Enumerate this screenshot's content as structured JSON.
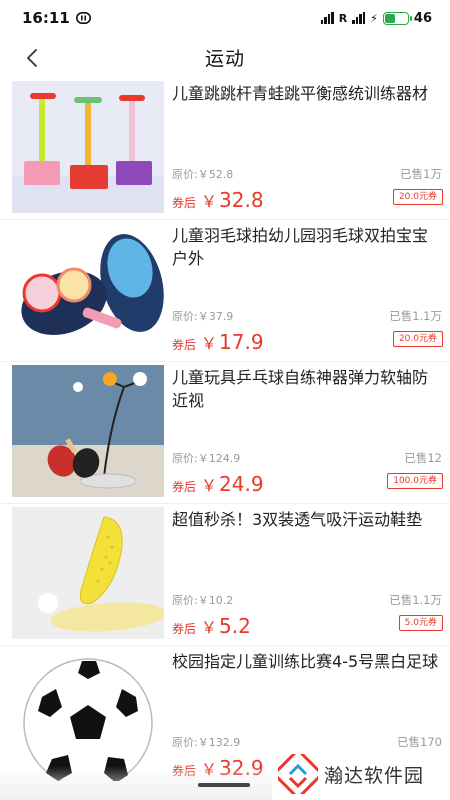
{
  "status_bar": {
    "time": "16:11",
    "battery": "46",
    "battery_level": 0.46
  },
  "nav": {
    "title": "运动"
  },
  "products": [
    {
      "title": "儿童跳跳杆青蛙跳平衡感统训练器材",
      "original_price": "原价:￥52.8",
      "sold": "已售1万",
      "label": "券后",
      "currency": "￥",
      "price": "32.8",
      "coupon": "20.0元券",
      "image": "pogo-jumper-image"
    },
    {
      "title": "儿童羽毛球拍幼儿园羽毛球双拍宝宝户外",
      "original_price": "原价:￥37.9",
      "sold": "已售1.1万",
      "label": "券后",
      "currency": "￥",
      "price": "17.9",
      "coupon": "20.0元券",
      "image": "badminton-racket-image"
    },
    {
      "title": "儿童玩具乒乓球自练神器弹力软轴防近视",
      "original_price": "原价:￥124.9",
      "sold": "已售12",
      "label": "券后",
      "currency": "￥",
      "price": "24.9",
      "coupon": "100.0元券",
      "image": "table-tennis-trainer-image"
    },
    {
      "title": "超值秒杀！3双装透气吸汗运动鞋垫",
      "original_price": "原价:￥10.2",
      "sold": "已售1.1万",
      "label": "券后",
      "currency": "￥",
      "price": "5.2",
      "coupon": "5.0元券",
      "image": "insole-image"
    },
    {
      "title": "校园指定儿童训练比赛4-5号黑白足球",
      "original_price": "原价:￥132.9",
      "sold": "已售170",
      "label": "券后",
      "currency": "￥",
      "price": "32.9",
      "coupon": "",
      "image": "soccer-ball-image"
    }
  ],
  "watermark": {
    "text": "瀚达软件园"
  },
  "colors": {
    "accent": "#e8392a",
    "muted": "#999999",
    "battery": "#2aa84a"
  }
}
